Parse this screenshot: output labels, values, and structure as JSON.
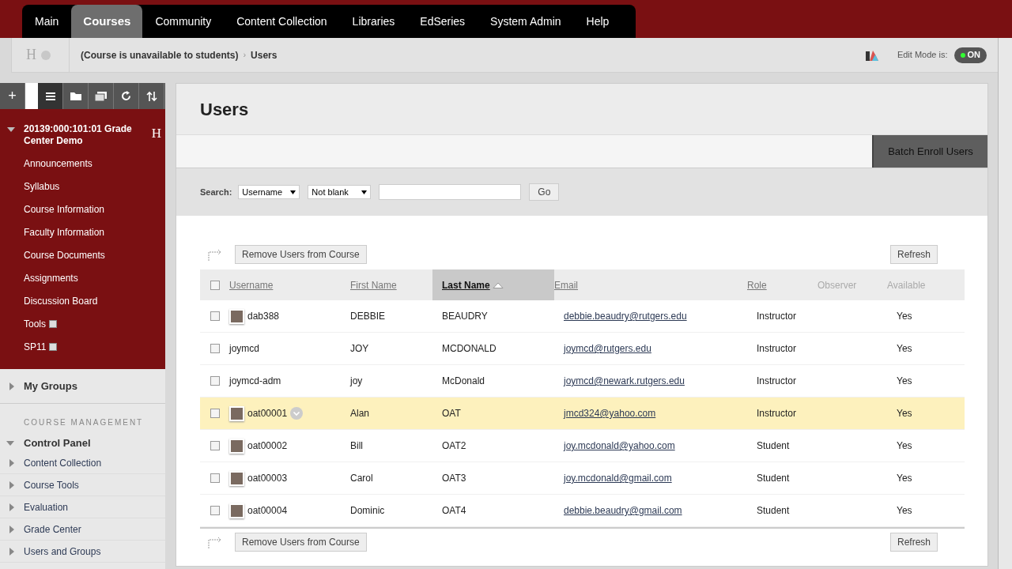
{
  "top_tabs": [
    {
      "label": "Main",
      "selected": false
    },
    {
      "label": "Courses",
      "selected": true
    },
    {
      "label": "Community",
      "selected": false
    },
    {
      "label": "Content Collection",
      "selected": false
    },
    {
      "label": "Libraries",
      "selected": false
    },
    {
      "label": "EdSeries",
      "selected": false
    },
    {
      "label": "System Admin",
      "selected": false
    },
    {
      "label": "Help",
      "selected": false
    }
  ],
  "breadcrumb": {
    "home": "H",
    "separator": "›",
    "items": [
      "(Course is unavailable to students)",
      "Users"
    ]
  },
  "edit_mode": {
    "label": "Edit Mode is:",
    "value": "ON",
    "on": true
  },
  "sidebar": {
    "add_button": "+",
    "course": {
      "title": "20139:000:101:01 Grade Center Demo",
      "icon": "H",
      "expanded": true
    },
    "course_items": [
      {
        "label": "Announcements",
        "hidden": false
      },
      {
        "label": "Syllabus",
        "hidden": false
      },
      {
        "label": "Course Information",
        "hidden": false
      },
      {
        "label": "Faculty Information",
        "hidden": false
      },
      {
        "label": "Course Documents",
        "hidden": false
      },
      {
        "label": "Assignments",
        "hidden": false
      },
      {
        "label": "Discussion Board",
        "hidden": false
      },
      {
        "label": "Tools",
        "hidden": true
      },
      {
        "label": "SP11",
        "hidden": true
      }
    ],
    "my_groups": {
      "label": "My Groups",
      "expanded": false
    },
    "management_heading": "COURSE MANAGEMENT",
    "control_panel": {
      "label": "Control Panel",
      "expanded": true
    },
    "control_items": [
      {
        "label": "Content Collection",
        "expanded": false
      },
      {
        "label": "Course Tools",
        "expanded": false
      },
      {
        "label": "Evaluation",
        "expanded": false
      },
      {
        "label": "Grade Center",
        "expanded": false
      },
      {
        "label": "Users and Groups",
        "expanded": false
      }
    ]
  },
  "page": {
    "title": "Users",
    "action_button": "Batch Enroll Users",
    "search": {
      "label": "Search:",
      "field": "Username",
      "condition": "Not blank",
      "button": "Go"
    },
    "action_rows": [
      {
        "remove_button": "Remove Users from Course",
        "refresh_button": "Refresh"
      },
      {
        "remove_button": "Remove Users from Course",
        "refresh_button": "Refresh"
      }
    ]
  },
  "table": {
    "select_all_checked": false,
    "columns": [
      {
        "label": "Username",
        "link": true,
        "sorted": false
      },
      {
        "label": "First Name",
        "link": true,
        "sorted": false
      },
      {
        "label": "Last Name",
        "link": true,
        "sorted": true
      },
      {
        "label": "Email",
        "link": true,
        "sorted": false
      },
      {
        "label": "Role",
        "link": true,
        "sorted": false
      },
      {
        "label": "Observer",
        "link": false,
        "sorted": false
      },
      {
        "label": "Available",
        "link": false,
        "sorted": false
      }
    ],
    "rows": [
      {
        "username": "dab388",
        "avatar": true,
        "first": "DEBBIE",
        "last": "BEAUDRY",
        "email": "debbie.beaudry@rutgers.edu",
        "role": "Instructor",
        "available": "Yes",
        "checked": false,
        "selected": false
      },
      {
        "username": "joymcd",
        "avatar": false,
        "first": "JOY",
        "last": "MCDONALD",
        "email": "joymcd@rutgers.edu",
        "role": "Instructor",
        "available": "Yes",
        "checked": false,
        "selected": false
      },
      {
        "username": "joymcd-adm",
        "avatar": false,
        "first": "joy",
        "last": "McDonald",
        "email": "joymcd@newark.rutgers.edu",
        "role": "Instructor",
        "available": "Yes",
        "checked": false,
        "selected": false
      },
      {
        "username": "oat00001",
        "avatar": true,
        "first": "Alan",
        "last": "OAT",
        "email": "jmcd324@yahoo.com",
        "role": "Instructor",
        "available": "Yes",
        "checked": false,
        "selected": true
      },
      {
        "username": "oat00002",
        "avatar": true,
        "first": "Bill",
        "last": "OAT2",
        "email": "joy.mcdonald@yahoo.com",
        "role": "Student",
        "available": "Yes",
        "checked": false,
        "selected": false
      },
      {
        "username": "oat00003",
        "avatar": true,
        "first": "Carol",
        "last": "OAT3",
        "email": "joy.mcdonald@gmail.com",
        "role": "Student",
        "available": "Yes",
        "checked": false,
        "selected": false
      },
      {
        "username": "oat00004",
        "avatar": true,
        "first": "Dominic",
        "last": "OAT4",
        "email": "debbie.beaudry@gmail.com",
        "role": "Student",
        "available": "Yes",
        "checked": false,
        "selected": false
      }
    ]
  }
}
